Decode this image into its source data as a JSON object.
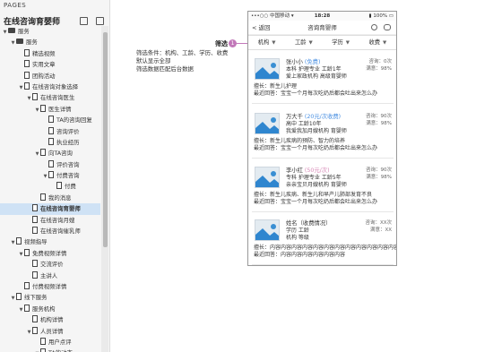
{
  "sidebar": {
    "title": "PAGES",
    "project_name": "在线咨询育婴师",
    "tree": [
      {
        "label": "服务",
        "level": 0,
        "type": "folder",
        "caret": "open"
      },
      {
        "label": "服务",
        "level": 1,
        "type": "folder",
        "caret": "open"
      },
      {
        "label": "精选视频",
        "level": 2,
        "type": "page",
        "caret": "none"
      },
      {
        "label": "实用文章",
        "level": 2,
        "type": "page",
        "caret": "none"
      },
      {
        "label": "团购活动",
        "level": 2,
        "type": "page",
        "caret": "none"
      },
      {
        "label": "在线咨询对象选择",
        "level": 2,
        "type": "page",
        "caret": "open"
      },
      {
        "label": "在线咨询医生",
        "level": 3,
        "type": "page",
        "caret": "open"
      },
      {
        "label": "医生详情",
        "level": 4,
        "type": "page",
        "caret": "open"
      },
      {
        "label": "TA的咨询回复",
        "level": 5,
        "type": "page",
        "caret": "none"
      },
      {
        "label": "咨询评价",
        "level": 5,
        "type": "page",
        "caret": "none"
      },
      {
        "label": "执业经历",
        "level": 5,
        "type": "page",
        "caret": "none"
      },
      {
        "label": "向TA咨询",
        "level": 4,
        "type": "page",
        "caret": "open"
      },
      {
        "label": "评价咨询",
        "level": 5,
        "type": "page",
        "caret": "none"
      },
      {
        "label": "付费咨询",
        "level": 5,
        "type": "page",
        "caret": "open"
      },
      {
        "label": "付费",
        "level": 6,
        "type": "page",
        "caret": "none"
      },
      {
        "label": "我的消息",
        "level": 4,
        "type": "page",
        "caret": "none"
      },
      {
        "label": "在线咨询育婴师",
        "level": 3,
        "type": "page",
        "caret": "none",
        "selected": true
      },
      {
        "label": "在线咨询月嫂",
        "level": 3,
        "type": "page",
        "caret": "none"
      },
      {
        "label": "在线咨询催乳师",
        "level": 3,
        "type": "page",
        "caret": "none"
      },
      {
        "label": "视频指导",
        "level": 1,
        "type": "page",
        "caret": "open"
      },
      {
        "label": "免费视频详情",
        "level": 2,
        "type": "page",
        "caret": "open"
      },
      {
        "label": "交流评价",
        "level": 3,
        "type": "page",
        "caret": "none"
      },
      {
        "label": "主讲人",
        "level": 3,
        "type": "page",
        "caret": "none"
      },
      {
        "label": "付费视频详情",
        "level": 2,
        "type": "page",
        "caret": "none"
      },
      {
        "label": "线下服务",
        "level": 1,
        "type": "page",
        "caret": "open"
      },
      {
        "label": "服务机构",
        "level": 2,
        "type": "page",
        "caret": "open"
      },
      {
        "label": "机构详情",
        "level": 3,
        "type": "page",
        "caret": "none"
      },
      {
        "label": "人员详情",
        "level": 3,
        "type": "page",
        "caret": "open"
      },
      {
        "label": "用户点评",
        "level": 4,
        "type": "page",
        "caret": "none"
      },
      {
        "label": "TA的动态",
        "level": 4,
        "type": "page",
        "caret": "open"
      }
    ]
  },
  "annotation": {
    "label": "筛选",
    "badge": "1",
    "lines": [
      "筛选条件：机构、工龄、学历、收费",
      "默认显示全部",
      "筛选数据匹配后台数据"
    ]
  },
  "phone": {
    "status": {
      "carrier": "•••○○ 中国移动 ▾",
      "time": "18:28",
      "battery": "▮ 100% ▭"
    },
    "nav": {
      "back": "< 返回",
      "title": "咨询育婴师",
      "search_icon": "search-icon",
      "message_icon": "message-icon"
    },
    "filters": [
      {
        "label": "机构"
      },
      {
        "label": "工龄"
      },
      {
        "label": "学历"
      },
      {
        "label": "收费"
      }
    ],
    "cards": [
      {
        "name": "张小小",
        "tag": "(免费)",
        "tag_color": "#4a90e2",
        "line1": "本科 护理专业 工龄1年",
        "line2": "爱上家政机构 高级育婴师",
        "consult": "咨询：",
        "consult_val": "0次",
        "satisfaction": "满意：98%",
        "desc1": "擅长：新生儿护理",
        "desc2": "最近回答：宝宝一个月每次吃奶后都会吐出来怎么办"
      },
      {
        "name": "万大千",
        "tag": "(20元/次收费)",
        "tag_color": "#4a90e2",
        "line1": "高中 工龄10年",
        "line2": "我爱我加月嫂机构 育婴师",
        "consult": "咨询：",
        "consult_val": "90次",
        "satisfaction": "满意：98%",
        "desc1": "擅长：新生儿疾病的预防、智力的培养",
        "desc2": "最近回答：宝宝一个月每次吃奶后都会吐出来怎么办"
      },
      {
        "name": "李小红",
        "tag": "(50元/次)",
        "tag_color": "#d88bb8",
        "line1": "专科 护理专业 工龄5年",
        "line2": "亲亲宝贝月嫂机构 育婴师",
        "consult": "咨询：",
        "consult_val": "90次",
        "satisfaction": "满意：98%",
        "desc1": "擅长：新生儿疾病、新生儿和早产儿肺部发育不良",
        "desc2": "最近回答：宝宝一个月每次吃奶后都会吐出来怎么办"
      },
      {
        "name": "姓名（收费情况）",
        "tag": "",
        "tag_color": "#4a90e2",
        "line1": "学历 工龄",
        "line2": "机构 等级",
        "consult": "咨询：",
        "consult_val": "XX次",
        "satisfaction": "满意：XX",
        "desc1": "擅长：内容内容内容内容内容内容内容内容内容内容内容内容内容",
        "desc2": "最近回答：内容内容内容内容内容内容"
      }
    ]
  }
}
